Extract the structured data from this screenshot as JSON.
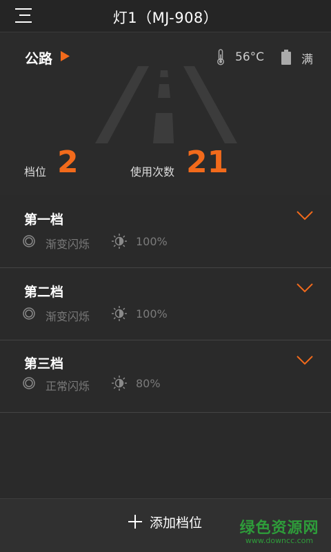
{
  "header": {
    "title": "灯1（MJ-908）"
  },
  "hero": {
    "mode_label": "公路",
    "temperature": "56°C",
    "battery": "满",
    "gear_label": "档位",
    "gear_value": "2",
    "usage_label": "使用次数",
    "usage_value": "21"
  },
  "levels": [
    {
      "name": "第一档",
      "mode": "渐变闪烁",
      "brightness": "100%"
    },
    {
      "name": "第二档",
      "mode": "渐变闪烁",
      "brightness": "100%"
    },
    {
      "name": "第三档",
      "mode": "正常闪烁",
      "brightness": "80%"
    }
  ],
  "footer": {
    "add_label": "添加档位"
  },
  "watermark": {
    "main": "绿色资源网",
    "sub": "www.downcc.com"
  },
  "colors": {
    "accent": "#f26a1b",
    "background": "#2a2a2a"
  }
}
